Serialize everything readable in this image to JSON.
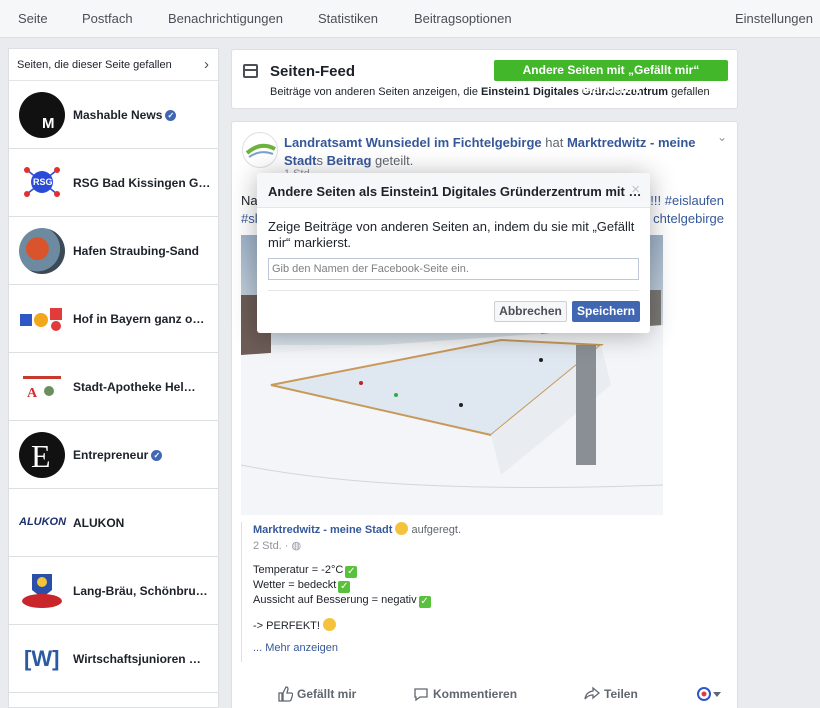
{
  "topnav": {
    "items": [
      "Seite",
      "Postfach",
      "Benachrichtigungen",
      "Statistiken",
      "Beitragsoptionen"
    ],
    "settings": "Einstellungen"
  },
  "sidebar": {
    "title": "Seiten, die dieser Seite gefallen",
    "items": [
      {
        "label": "Mashable News",
        "verified": true
      },
      {
        "label": "RSG Bad Kissingen G…",
        "verified": false
      },
      {
        "label": "Hafen Straubing-Sand",
        "verified": false
      },
      {
        "label": "Hof in Bayern ganz o…",
        "verified": false
      },
      {
        "label": "Stadt-Apotheke Hel…",
        "verified": false
      },
      {
        "label": "Entrepreneur",
        "verified": true
      },
      {
        "label": "ALUKON",
        "verified": false
      },
      {
        "label": "Lang-Bräu, Schönbru…",
        "verified": false
      },
      {
        "label": "Wirtschaftsjunioren …",
        "verified": false
      }
    ],
    "logo_texts": {
      "rsg": "RSG",
      "alukon": "ALUKON",
      "wj": "[W]",
      "entrepreneur": "E",
      "mashable": "M"
    }
  },
  "feed": {
    "title": "Seiten-Feed",
    "subtitle_pre": "Beiträge von anderen Seiten anzeigen, die ",
    "subtitle_page": "Einstein1 Digitales Gründerzentrum",
    "subtitle_post": " gefallen",
    "like_other_pages_button": "Andere Seiten mit „Gefällt mir“ markieren"
  },
  "post": {
    "author": "Landratsamt Wunsiedel im Fichtelgebirge",
    "has": " hat ",
    "shared_page": "Marktredwitz - meine Stadt",
    "shared_page_tail": "s ",
    "beitrag": "Beitrag",
    "geteilt": " geteilt.",
    "time": "1 Std. ·",
    "text_line1_left": "Na",
    "text_line1_right": "!!! #eislaufen",
    "text_line2_left": "#sl",
    "text_line2_right": "chtelgebirge",
    "shared_author": "Marktredwitz - meine Stadt",
    "shared_feeling": "aufgeregt.",
    "shared_time": "2 Std. ·",
    "lines": [
      "Temperatur = -2°C",
      "Wetter = bedeckt",
      "Aussicht auf Besserung = negativ"
    ],
    "perfekt": "-> PERFEKT!",
    "more": "... Mehr anzeigen",
    "actions": {
      "like": "Gefällt mir",
      "comment": "Kommentieren",
      "share": "Teilen"
    }
  },
  "modal": {
    "title": "Andere Seiten als Einstein1 Digitales Gründerzentrum mit …",
    "close": "×",
    "body": "Zeige Beiträge von anderen Seiten an, indem du sie mit „Gefällt mir“ markierst.",
    "input_placeholder": "Gib den Namen der Facebook-Seite ein.",
    "cancel": "Abbrechen",
    "save": "Speichern"
  }
}
